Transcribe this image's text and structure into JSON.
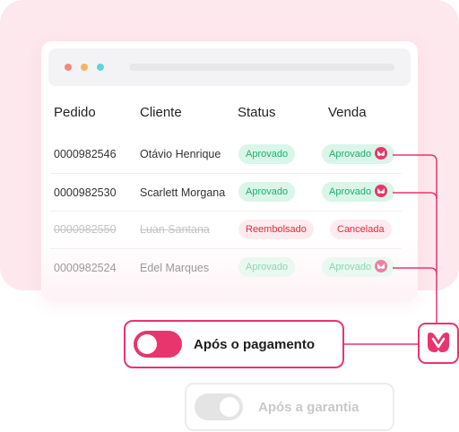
{
  "table": {
    "headers": [
      "Pedido",
      "Cliente",
      "Status",
      "Venda"
    ],
    "rows": [
      {
        "pedido": "0000982546",
        "cliente": "Otávio Henrique",
        "status": "Aprovado",
        "venda": "Aprovado"
      },
      {
        "pedido": "0000982530",
        "cliente": "Scarlett Morgana",
        "status": "Aprovado",
        "venda": "Aprovado"
      },
      {
        "pedido": "0000982550",
        "cliente": "Luan Santana",
        "status": "Reembolsado",
        "venda": "Cancelada"
      },
      {
        "pedido": "0000982524",
        "cliente": "Edel Marques",
        "status": "Aprovado",
        "venda": "Aprovado"
      }
    ]
  },
  "toggles": {
    "after_payment": {
      "label": "Após o pagamento",
      "on": true
    },
    "after_guarantee": {
      "label": "Após a garantia",
      "on": false
    }
  },
  "colors": {
    "brand": "#e8356e",
    "panel_bg": "#fde8ee",
    "approved": "#1fae6e",
    "cancelled": "#e8283f"
  },
  "icons": {
    "badge_icon": "brand-heart-icon",
    "brand_logo": "brand-heart-logo-icon"
  }
}
